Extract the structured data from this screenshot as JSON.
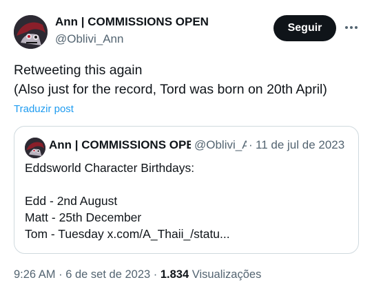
{
  "author": {
    "name": "Ann | COMMISSIONS OPEN",
    "handle": "@Oblivi_Ann"
  },
  "follow_label": "Seguir",
  "tweet": {
    "lines": [
      "Retweeting this again",
      "(Also just for the record, Tord was born on 20th April)"
    ],
    "translate_label": "Traduzir post"
  },
  "quoted": {
    "name": "Ann | COMMISSIONS OPEN",
    "handle": "@Oblivi_Ann",
    "date": "11 de jul de 2023",
    "lines": [
      "Eddsworld Character Birthdays:",
      "",
      "Edd - 2nd August",
      "Matt - 25th December",
      "Tom - Tuesday x.com/A_Thaii_/statu..."
    ]
  },
  "meta": {
    "time": "9:26 AM",
    "date": "6 de set de 2023",
    "views_count": "1.834",
    "views_label": "Visualizações"
  },
  "icons": {
    "more": "more-horizontal-icon"
  }
}
